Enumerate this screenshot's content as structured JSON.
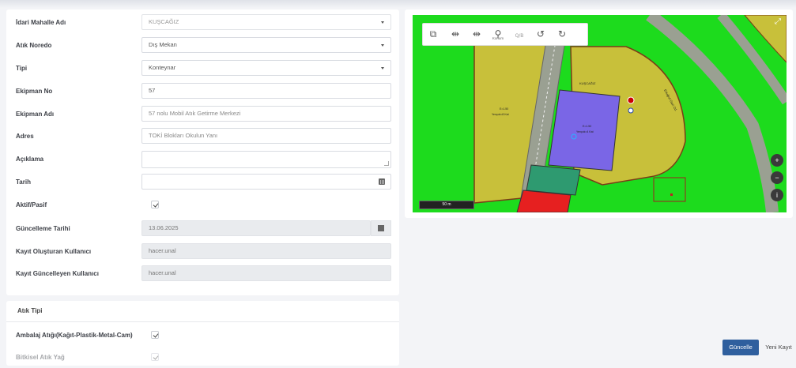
{
  "form": {
    "fields": [
      {
        "label": "İdari Mahalle Adı",
        "value": "KUŞCAĞIZ"
      },
      {
        "label": "Atık Noredo",
        "value": "Dış Mekan"
      },
      {
        "label": "Tipi",
        "value": "Konteynar"
      },
      {
        "label": "Ekipman No",
        "value": "57"
      },
      {
        "label": "Ekipman Adı",
        "value": "57 nolu Mobil Atık Getirme Merkezi"
      },
      {
        "label": "Adres",
        "value": "TOKİ Blokları Okulun Yanı"
      },
      {
        "label": "Açıklama",
        "value": ""
      },
      {
        "label": "Tarih",
        "value": ""
      },
      {
        "label": "Aktif/Pasif",
        "checked": true
      },
      {
        "label": "Güncelleme Tarihi",
        "value": "13.06.2025"
      },
      {
        "label": "Kayıt Oluşturan Kullanıcı",
        "value": "hacer.unal"
      },
      {
        "label": "Kayıt Güncelleyen Kullanıcı",
        "value": "hacer.unal"
      }
    ]
  },
  "atik_tipi": {
    "title": "Atık Tipi",
    "items": [
      {
        "label": "Ambalaj Atığı(Kağıt-Plastik-Metal-Cam)",
        "checked": true
      },
      {
        "label": "Bitkisel Atık Yağ",
        "checked": true
      }
    ]
  },
  "map": {
    "toolbar": [
      {
        "icon": "layers-icon",
        "glyph": "⧉",
        "sub": ""
      },
      {
        "icon": "measure-line-icon",
        "glyph": "⇹",
        "sub": ""
      },
      {
        "icon": "measure-area-icon",
        "glyph": "⇹",
        "sub": ""
      },
      {
        "icon": "location-pin-icon",
        "glyph": "⚲",
        "sub": "Konum"
      },
      {
        "icon": "coordinate-icon",
        "glyph": "⊞",
        "sub": "Q/B"
      },
      {
        "icon": "undo-icon",
        "glyph": "↺",
        "sub": ""
      },
      {
        "icon": "redo-icon",
        "glyph": "↻",
        "sub": ""
      }
    ],
    "scale_label": "50 m",
    "parcel_labels": [
      {
        "name": "KUŞCAĞIZ",
        "line1": "E=1.50",
        "line2": "Yençok=4 Kat"
      },
      {
        "name": "",
        "line1": "E=1.50",
        "line2": "Yençok=8 Kat"
      },
      {
        "name": "",
        "line1": "E=1.50",
        "line2": "Yençok=4 Kat"
      }
    ],
    "road_label": "Ertuğrul Gazi Cd."
  },
  "buttons": {
    "update": "Güncelle",
    "new_record": "Yeni Kayıt"
  },
  "colors": {
    "primary": "#2f5f9e",
    "map_green": "#1ddb1d",
    "map_olive": "#c8c03a",
    "map_blue": "#7a66e6",
    "map_red": "#e62020",
    "map_teal": "#2e9a70"
  }
}
